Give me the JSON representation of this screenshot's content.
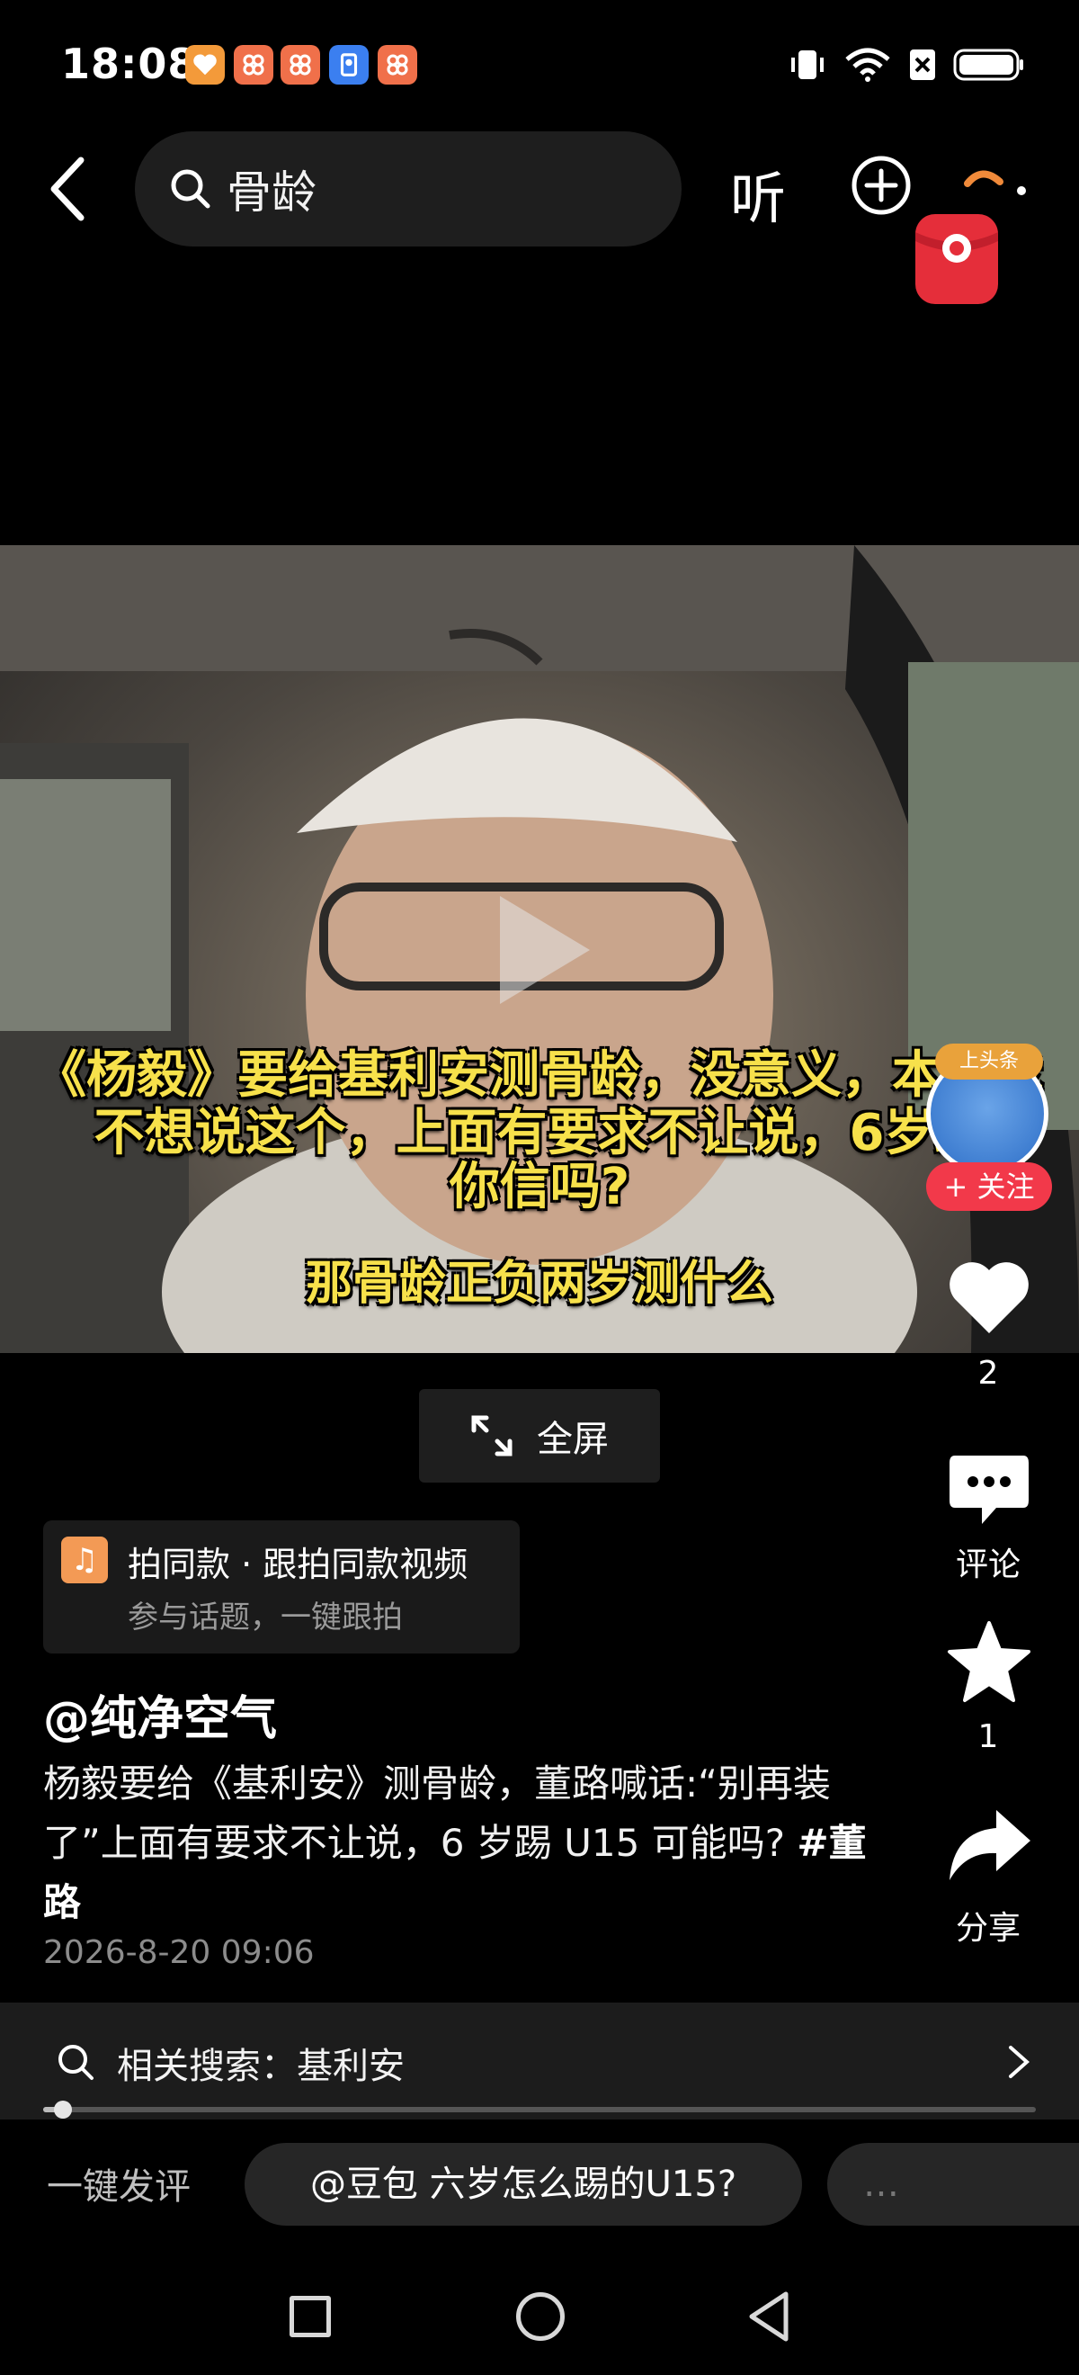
{
  "status_bar": {
    "time": "18:08",
    "battery_icon": "battery-icon",
    "wifi_icon": "wifi-icon",
    "signal_icon": "no-sim-icon"
  },
  "header": {
    "search_query": "骨龄",
    "listen_label": "听"
  },
  "video": {
    "subtitle_line1": "《杨毅》要给基利安测骨龄，没意义，本来我",
    "subtitle_line2": "不想说这个，上面有要求不让说，6岁踢",
    "subtitle_line3": "你信吗?",
    "subtitle_line4": "那骨龄正负两岁测什么"
  },
  "side_actions": {
    "avatar_badge": "上头条",
    "follow_label": "+ 关注",
    "like_count": "2",
    "comment_label": "评论",
    "favorite_count": "1",
    "share_label": "分享"
  },
  "fullscreen_label": "全屏",
  "template_card": {
    "title": "拍同款 · 跟拍同款视频",
    "subtitle": "参与话题，一键跟拍"
  },
  "post": {
    "author": "@纯净空气",
    "description": "杨毅要给《基利安》测骨龄，董路喊话:“别再装了”上面有要求不让说，6 岁踢 U15 可能吗? ",
    "hashtag": "#董路",
    "time": "2026-8-20 09:06"
  },
  "related_search": {
    "label": "相关搜索：基利安"
  },
  "progress": {
    "fraction": 0.02
  },
  "quick_comment": {
    "label": "一键发评",
    "chips": [
      "@豆包 六岁怎么踢的U15?",
      "…"
    ]
  },
  "colors": {
    "accent_red": "#f2394a",
    "subtitle_yellow": "#f7e14b",
    "background": "#000000"
  }
}
